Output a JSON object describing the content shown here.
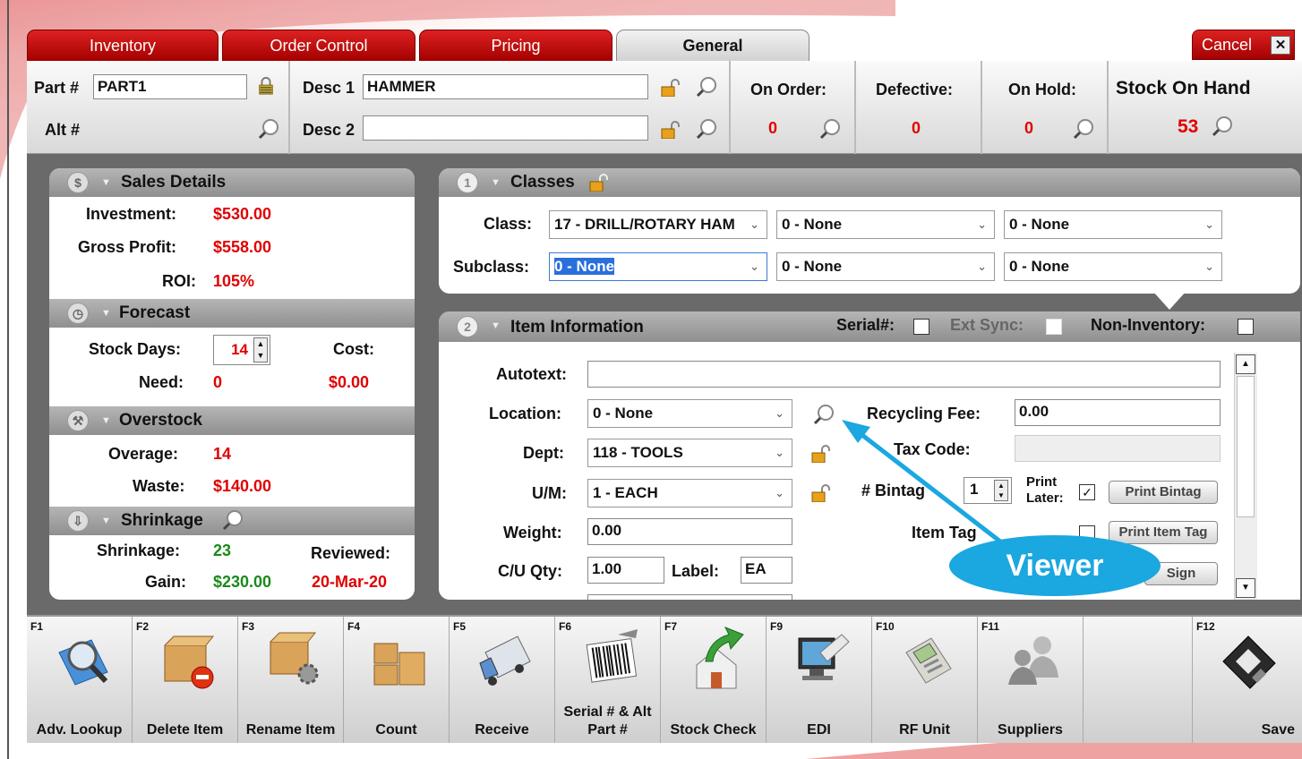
{
  "tabs": [
    "Inventory",
    "Order Control",
    "Pricing",
    "General"
  ],
  "cancel_label": "Cancel",
  "header": {
    "part_label": "Part #",
    "part_value": "PART1",
    "alt_label": "Alt #",
    "desc1_label": "Desc 1",
    "desc1_value": "HAMMER",
    "desc2_label": "Desc 2",
    "desc2_value": "",
    "on_order_label": "On Order:",
    "on_order_value": "0",
    "defective_label": "Defective:",
    "defective_value": "0",
    "on_hold_label": "On Hold:",
    "on_hold_value": "0",
    "stock_label": "Stock On Hand",
    "stock_value": "53"
  },
  "sales": {
    "title": "Sales Details",
    "investment_label": "Investment:",
    "investment": "$530.00",
    "gross_label": "Gross Profit:",
    "gross": "$558.00",
    "roi_label": "ROI:",
    "roi": "105%"
  },
  "forecast": {
    "title": "Forecast",
    "stock_days_label": "Stock Days:",
    "stock_days": "14",
    "cost_label": "Cost:",
    "cost": "$0.00",
    "need_label": "Need:",
    "need": "0"
  },
  "overstock": {
    "title": "Overstock",
    "overage_label": "Overage:",
    "overage": "14",
    "waste_label": "Waste:",
    "waste": "$140.00"
  },
  "shrinkage": {
    "title": "Shrinkage",
    "shrink_label": "Shrinkage:",
    "shrink": "23",
    "gain_label": "Gain:",
    "gain": "$230.00",
    "reviewed_label": "Reviewed:",
    "reviewed": "20-Mar-20"
  },
  "classes": {
    "num": "1",
    "title": "Classes",
    "class_label": "Class:",
    "subclass_label": "Subclass:",
    "class1": "17 - DRILL/ROTARY HAM",
    "class2": "0 - None",
    "class3": "0 - None",
    "sub1": "0 - None",
    "sub2": "0 - None",
    "sub3": "0 - None"
  },
  "item": {
    "num": "2",
    "title": "Item Information",
    "serial_label": "Serial#:",
    "ext_sync_label": "Ext Sync:",
    "non_inv_label": "Non-Inventory:",
    "autotext_label": "Autotext:",
    "autotext": "",
    "location_label": "Location:",
    "location": "0 - None",
    "dept_label": "Dept:",
    "dept": "118 - TOOLS",
    "um_label": "U/M:",
    "um": "1 - EACH",
    "weight_label": "Weight:",
    "weight": "0.00",
    "cu_label": "C/U Qty:",
    "cu": "1.00",
    "label_label": "Label:",
    "label": "EA",
    "recycling_label": "Recycling Fee:",
    "recycling": "0.00",
    "tax_label": "Tax Code:",
    "bintag_label": "# Bintag",
    "bintag": "1",
    "print_later": "Print Later:",
    "print_bintag": "Print Bintag",
    "item_tag_label": "Item Tag",
    "print_item_tag": "Print Item Tag",
    "sign_btn": "Sign"
  },
  "callout": "Viewer",
  "fkeys": [
    {
      "key": "F1",
      "label": "Adv. Lookup",
      "icon": "magnifier-icon"
    },
    {
      "key": "F2",
      "label": "Delete Item",
      "icon": "box-delete-icon"
    },
    {
      "key": "F3",
      "label": "Rename Item",
      "icon": "box-gear-icon"
    },
    {
      "key": "F4",
      "label": "Count",
      "icon": "boxes-icon"
    },
    {
      "key": "F5",
      "label": "Receive",
      "icon": "truck-icon"
    },
    {
      "key": "F6",
      "label": "Serial # & Alt Part #",
      "icon": "barcode-icon"
    },
    {
      "key": "F7",
      "label": "Stock Check",
      "icon": "house-arrow-icon"
    },
    {
      "key": "F9",
      "label": "EDI",
      "icon": "computer-icon"
    },
    {
      "key": "F10",
      "label": "RF Unit",
      "icon": "rf-device-icon"
    },
    {
      "key": "F11",
      "label": "Suppliers",
      "icon": "people-icon"
    },
    {
      "key": "",
      "label": "",
      "icon": ""
    },
    {
      "key": "F12",
      "label": "Save",
      "icon": "floppy-disk-icon"
    }
  ]
}
